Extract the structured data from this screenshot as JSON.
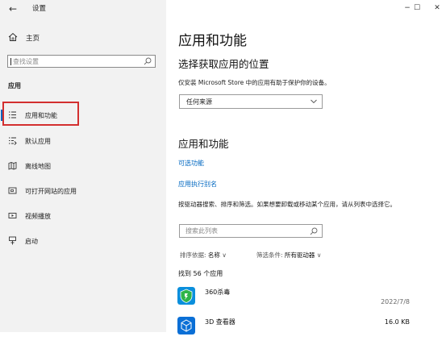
{
  "window": {
    "title": "设置",
    "minimize": "−",
    "maximize": "☐",
    "close": "✕"
  },
  "sidebar": {
    "home_label": "主页",
    "search_placeholder": "查找设置",
    "section_label": "应用",
    "items": [
      {
        "label": "应用和功能",
        "icon": "apps-features-icon",
        "active": true
      },
      {
        "label": "默认应用",
        "icon": "default-apps-icon",
        "active": false
      },
      {
        "label": "离线地图",
        "icon": "offline-maps-icon",
        "active": false
      },
      {
        "label": "可打开网站的应用",
        "icon": "apps-for-websites-icon",
        "active": false
      },
      {
        "label": "视频播放",
        "icon": "video-playback-icon",
        "active": false
      },
      {
        "label": "启动",
        "icon": "startup-icon",
        "active": false
      }
    ]
  },
  "main": {
    "page_title": "应用和功能",
    "install_source": {
      "heading": "选择获取应用的位置",
      "description": "仅安装 Microsoft Store 中的应用有助于保护你的设备。",
      "selected": "任何来源"
    },
    "apps_section": {
      "heading": "应用和功能",
      "link_optional": "可选功能",
      "link_alias": "应用执行别名",
      "help_text": "按驱动器搜索、排序和筛选。如果想要卸载或移动某个应用，请从列表中选择它。",
      "search_placeholder": "搜索此列表",
      "sort_label": "排序依据:",
      "sort_value": "名称",
      "filter_label": "筛选条件:",
      "filter_value": "所有驱动器",
      "count_text": "找到 56 个应用"
    },
    "apps": [
      {
        "name": "360杀毒",
        "size": "",
        "date": "2022/7/8"
      },
      {
        "name": "3D 查看器",
        "size": "16.0 KB",
        "date": ""
      }
    ]
  },
  "colors": {
    "accent": "#0067c0",
    "highlight_box": "#d32f2f",
    "sidebar_bg": "#f2f2f2"
  }
}
